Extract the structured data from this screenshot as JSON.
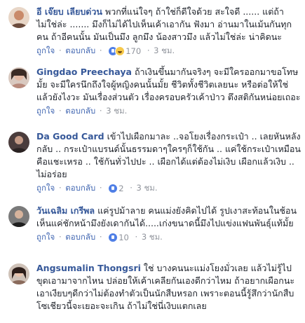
{
  "comments": [
    {
      "author": "อี เจ๊ยบ เลียบด่วน",
      "text": "พวกที่แน่ใจๆ ถ้าใช่ก็ดีใจด้วย สะใจดี ...... แต่ถ้าไม่ใช่ล่ะ ....... มึงก็ไม่ได้ไปเห็นเค้าเอากัน ฟังมา อ่านมาในเม้นกันทุกคน ถ้าอีคนนั้น มันเป็นมึง ลูกมึง น้องสาวมึง แล้วไม่ใช่ล่ะ น่าคิดนะ",
      "like": "ถูกใจ",
      "reply": "ตอบกลับ",
      "reaction_count": "170",
      "time": "3 ชม.",
      "reactions": [
        "like-reaction-icon",
        "haha-reaction-icon"
      ],
      "avatar_color": "#c98a6a"
    },
    {
      "author": "Gingdao Preechaya",
      "text": "ถ้าเงินขึ้นมากันจริงๆ จะมีใครออกมาขอโทษมั้ย จะมีใครนึกถึงใจผู้หญิงคนนั้นมั้ย ชีวิตทั้งชีวิตเลยนะ หรือต่อให้ใช่ แล้วยังไงวะ มันเรื่องส่วนตัว เรื่องครอบครัวเค้าป่าว ตึงสติกันหน่อยเถอะ",
      "like": "ถูกใจ",
      "reply": "ตอบกลับ",
      "reaction_count": "",
      "time": "3 ชม.",
      "reactions": [],
      "avatar_color": "#b88a7c"
    },
    {
      "author": "Da Good Card",
      "text": "เข้าไปเผือกมาละ ..จอโยงเรื่องกระเป๋า .. เลยหันหลังกลับ .. กระเป๋าแบรนด์นั้นธรรมดาๆใครๆก็ใช้กัน .. แค่ใช้กระเป๋าเหมือนคือแชะเหรอ .. ใช้กันทั่วไปปะ .. เผือกได้แต่ต้องไม่เงิบ เผือกแล้วเงิบ .. ไม่อร่อย",
      "like": "ถูกใจ",
      "reply": "ตอบกลับ",
      "reaction_count": "2",
      "time": "3 ชม.",
      "reactions": [
        "like-reaction-icon"
      ],
      "avatar_color": "#5a4a4a"
    },
    {
      "author": "วันเฉลิม เกรีพล",
      "text": "แค่รูปม้าลาย คนแม่งยังคิดไปได้ รูปเงาสะท้อนในช้อน เห็นแค่ชักหน้ามึงยังเดากันได้.....เก่งขนาดนี้มึงไปแข่งแฟนพันธุ์แท้มั้ย",
      "like": "ถูกใจ",
      "reply": "ตอบกลับ",
      "reaction_count": "10",
      "time": "3 ชม.",
      "reactions": [
        "like-reaction-icon"
      ],
      "avatar_color": "#3a3a3a"
    },
    {
      "author": "Angsumalin Thongsri",
      "text": "ใช่ บางคนนะแม่งโยงมั่วเลย แล้วไม่รู้ไปขุดเอามาจากไหน ปล่อยให้เค้าเคลียกันเองดีกว่าไหม ถ้าอยากเผือกนะเอาเงียบๆดีกว่าไม่ต้องทำตัวเป็นนักสืบหรอก เพราะตอนนี้รู้สึกว่านักสืบโซเชียวนี้จะเยอะจะเกิน ถ้าไม่ใช่นี่เงิบแตกเลย",
      "like": "",
      "reply": "",
      "reaction_count": "",
      "time": "",
      "reactions": [],
      "avatar_color": "#8a6b5c"
    }
  ]
}
